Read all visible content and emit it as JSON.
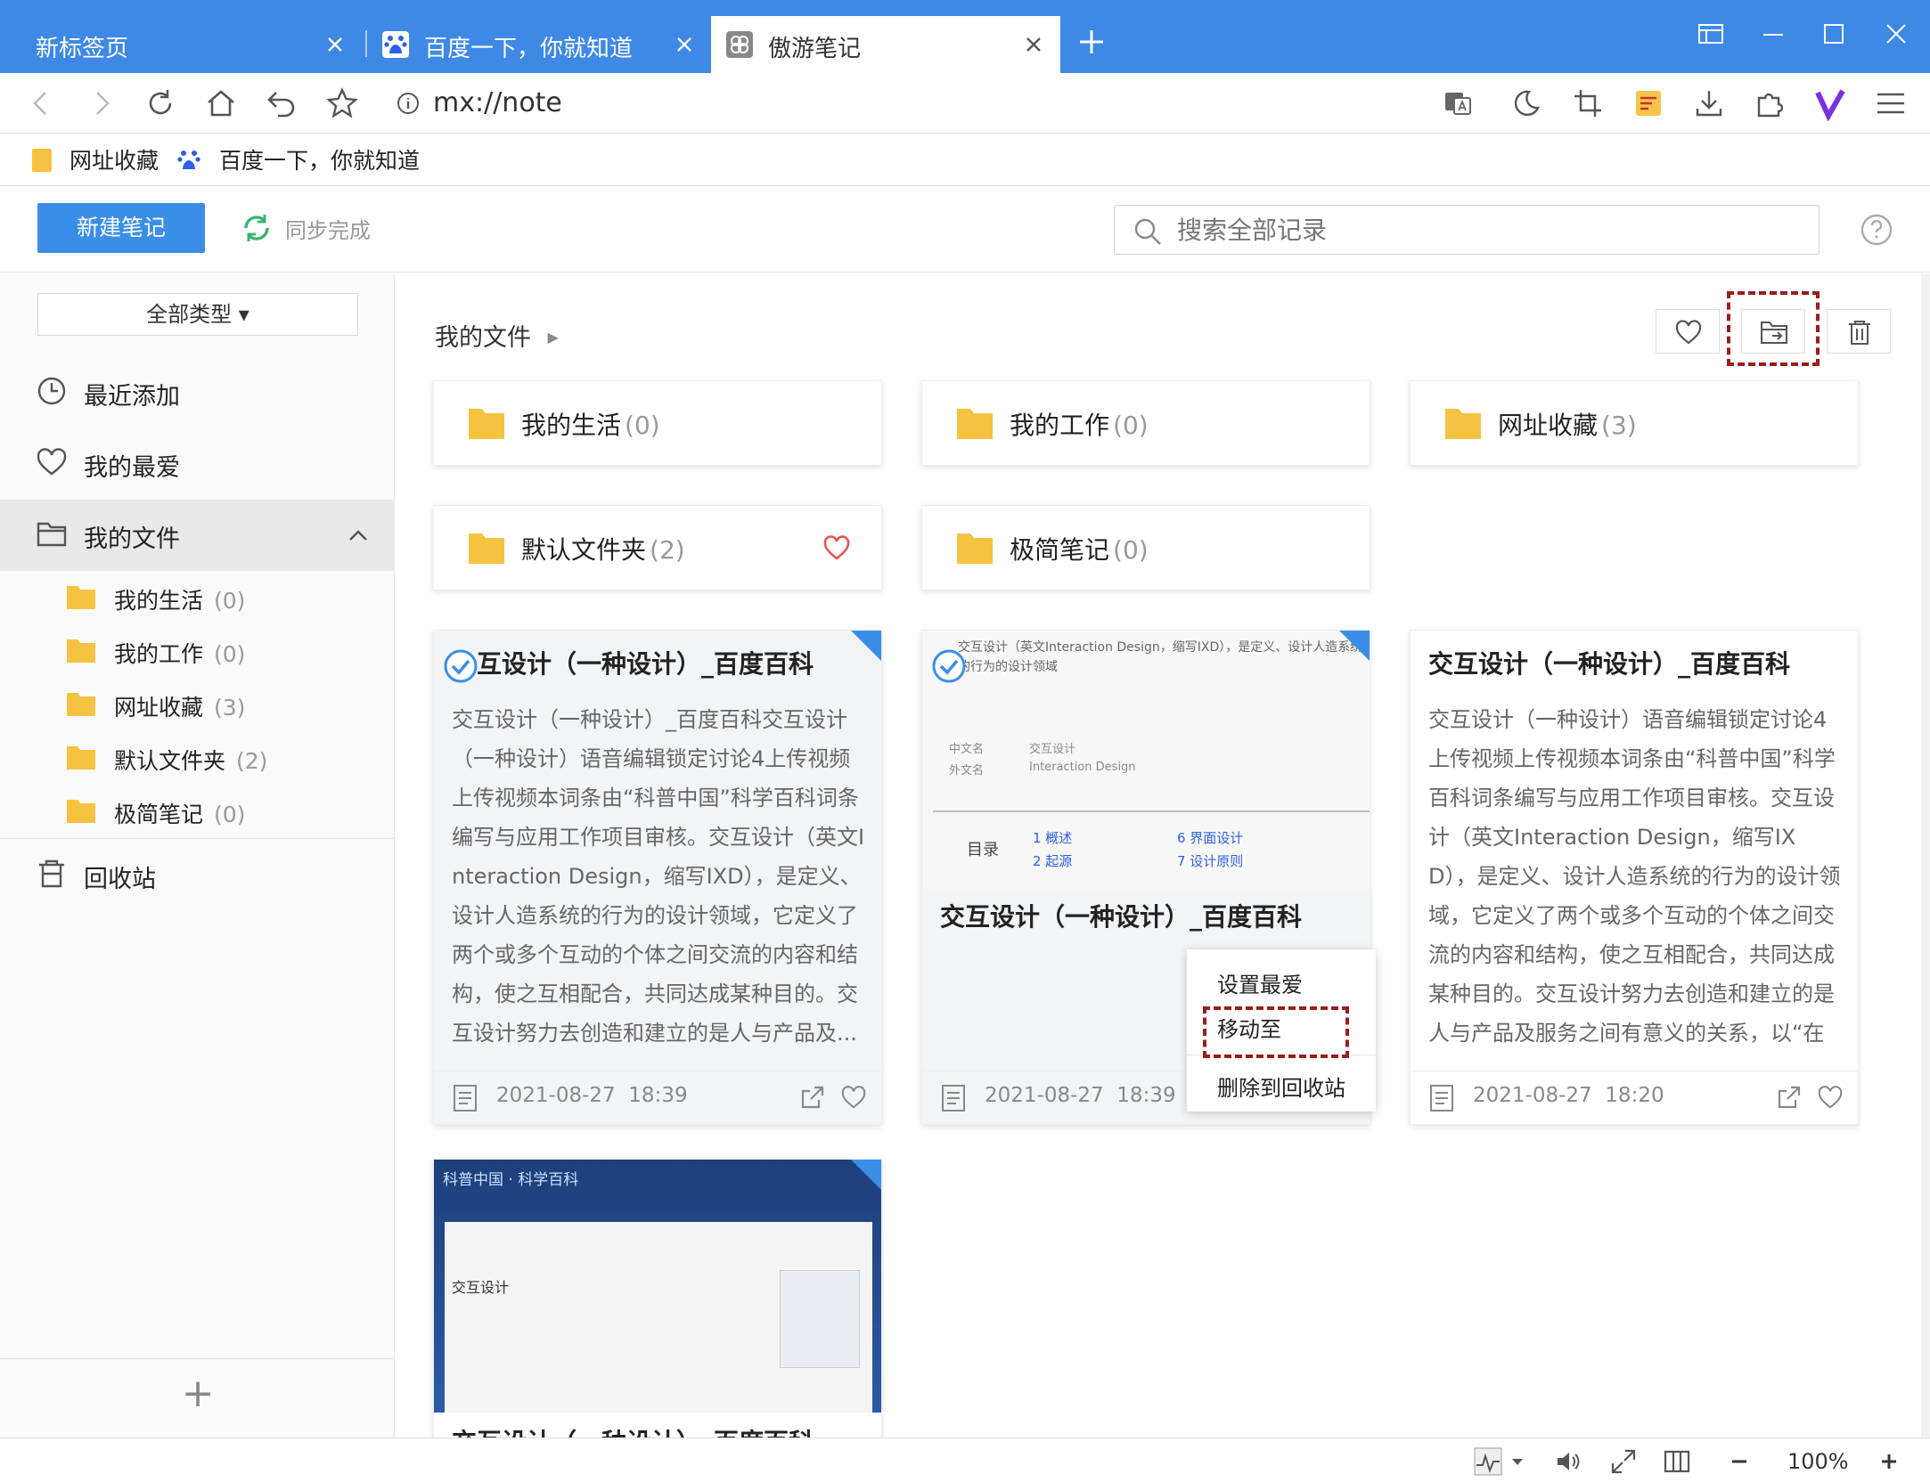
{
  "tabs": [
    {
      "label": "新标签页"
    },
    {
      "label": "百度一下，你就知道"
    },
    {
      "label": "傲游笔记"
    }
  ],
  "address": {
    "url": "mx://note"
  },
  "bookmarks": [
    {
      "label": "网址收藏"
    },
    {
      "label": "百度一下，你就知道"
    }
  ],
  "header": {
    "new_note": "新建笔记",
    "sync_status": "同步完成",
    "search_placeholder": "搜索全部记录"
  },
  "sidebar": {
    "type_filter": "全部类型 ▾",
    "nav": [
      {
        "label": "最近添加",
        "icon": "clock-icon"
      },
      {
        "label": "我的最爱",
        "icon": "heart-icon"
      },
      {
        "label": "我的文件",
        "icon": "folder-outline-icon"
      }
    ],
    "folders": [
      {
        "label": "我的生活",
        "count": "(0)"
      },
      {
        "label": "我的工作",
        "count": "(0)"
      },
      {
        "label": "网址收藏",
        "count": "(3)"
      },
      {
        "label": "默认文件夹",
        "count": "(2)"
      },
      {
        "label": "极简笔记",
        "count": "(0)"
      }
    ],
    "trash": "回收站",
    "add_symbol": "+"
  },
  "main": {
    "breadcrumb": "我的文件",
    "folders": [
      {
        "label": "我的生活",
        "count": "(0)"
      },
      {
        "label": "我的工作",
        "count": "(0)"
      },
      {
        "label": "网址收藏",
        "count": "(3)"
      },
      {
        "label": "默认文件夹",
        "count": "(2)"
      },
      {
        "label": "极简笔记",
        "count": "(0)"
      }
    ],
    "notes": [
      {
        "title": "互设计（一种设计）_百度百科",
        "body": "交互设计（一种设计）_百度百科交互设计（一种设计）语音编辑锁定讨论4上传视频上传视频本词条由“科普中国”科学百科词条编写与应用工作项目审核。交互设计（英文Interaction Design，缩写IXD），是定义、设计人造系统的行为的设计领域，它定义了两个或多个互动的个体之间交流的内容和结构，使之互相配合，共同达成某种目的。交互设计努力去创造和建立的是人与产品及...",
        "date": "2021-08-27",
        "time": "18:39"
      },
      {
        "title": "交互设计（一种设计）_百度百科",
        "date": "2021-08-27",
        "time": "18:39"
      },
      {
        "title": "交互设计（一种设计）_百度百科",
        "body": "交互设计（一种设计）语音编辑锁定讨论4上传视频上传视频本词条由“科普中国”科学百科词条编写与应用工作项目审核。交互设计（英文Interaction Design，缩写IXD），是定义、设计人造系统的行为的设计领域，它定义了两个或多个互动的个体之间交流的内容和结构，使之互相配合，共同达成某种目的。交互设计努力去创造和建立的是人与产品及服务之间有意义的关系，以“在充满社...",
        "date": "2021-08-27",
        "time": "18:20"
      },
      {
        "title": "交互设计（一种设计）_百度百科",
        "thumb_header": "科普中国 · 科学百科",
        "thumb_heading": "交互设计"
      }
    ],
    "thumb_text": {
      "row1": "交互设计（英文Interaction Design，缩写IXD），是定义、设计人造系统的行为的设计领域",
      "label_cn": "中文名",
      "value_cn": "交互设计",
      "label_en": "外文名",
      "value_en": "Interaction Design",
      "toc": "目录",
      "toc1": "1 概述",
      "toc2": "2 起源",
      "toc3": "6 界面设计",
      "toc4": "7 设计原则"
    }
  },
  "context_menu": {
    "favorite": "设置最爱",
    "move_to": "移动至",
    "delete": "删除到回收站"
  },
  "status": {
    "zoom": "100%"
  },
  "colors": {
    "accent": "#3a8ee8",
    "tabbar": "#3e88e6",
    "folder": "#f5c242",
    "highlight": "#9b1c1c"
  }
}
